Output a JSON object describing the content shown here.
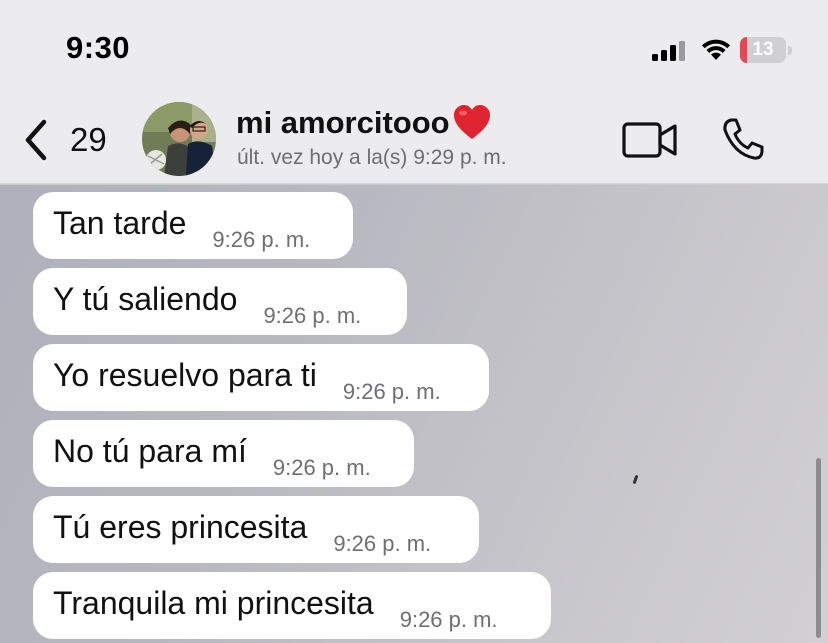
{
  "status_bar": {
    "time": "9:30",
    "battery_level": "13",
    "battery_color": "#e5484d"
  },
  "header": {
    "back_count": "29",
    "contact_name": "mi amorcitooo",
    "name_emoji": "heart-icon",
    "last_seen": "últ. vez hoy a la(s) 9:29 p. m.",
    "icons": [
      "chevron-left-icon",
      "video-camera-icon",
      "phone-icon"
    ]
  },
  "messages": [
    {
      "text": "Tan tarde",
      "time": "9:26 p. m."
    },
    {
      "text": "Y tú saliendo",
      "time": "9:26 p. m."
    },
    {
      "text": "Yo resuelvo para ti",
      "time": "9:26 p. m."
    },
    {
      "text": "No tú para mí",
      "time": "9:26 p. m."
    },
    {
      "text": "Tú eres princesita",
      "time": "9:26 p. m."
    },
    {
      "text": "Tranquila mi princesita",
      "time": "9:26 p. m."
    }
  ]
}
